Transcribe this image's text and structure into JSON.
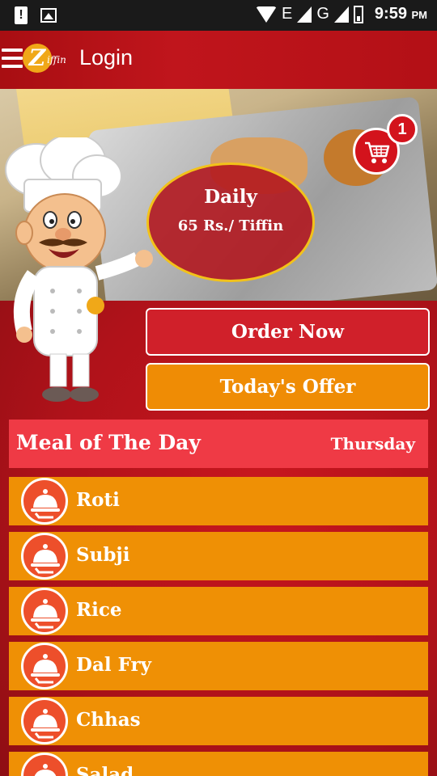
{
  "status_bar": {
    "time": "9:59",
    "ampm": "PM",
    "network": "E",
    "network2": "G"
  },
  "header": {
    "title": "Login",
    "logo_text": "Ziffin",
    "logo_letter": "Z",
    "logo_tail": "iffin"
  },
  "banner": {
    "daily_title": "Daily",
    "daily_price": "65 Rs./ Tiffin",
    "cart_count": "1"
  },
  "actions": {
    "order_now": "Order Now",
    "todays_offer": "Today's Offer"
  },
  "meal": {
    "title": "Meal of The Day",
    "day": "Thursday",
    "items": [
      {
        "label": "Roti"
      },
      {
        "label": "Subji"
      },
      {
        "label": "Rice"
      },
      {
        "label": "Dal Fry"
      },
      {
        "label": "Chhas"
      },
      {
        "label": "Salad"
      }
    ]
  },
  "colors": {
    "header_red": "#b31016",
    "order_red": "#d0202a",
    "offer_orange": "#ef8c05",
    "meal_header": "#ef3a45",
    "item_orange": "#ef9005",
    "icon_circle": "#ed4f2b",
    "daily_border": "#f2c21a"
  },
  "icons": {
    "menu": "hamburger-icon",
    "cart": "shopping-cart-icon",
    "dish": "cloche-icon",
    "wifi": "wifi-icon",
    "signal": "signal-icon",
    "battery": "battery-icon",
    "alert": "alert-icon",
    "image": "image-icon"
  }
}
